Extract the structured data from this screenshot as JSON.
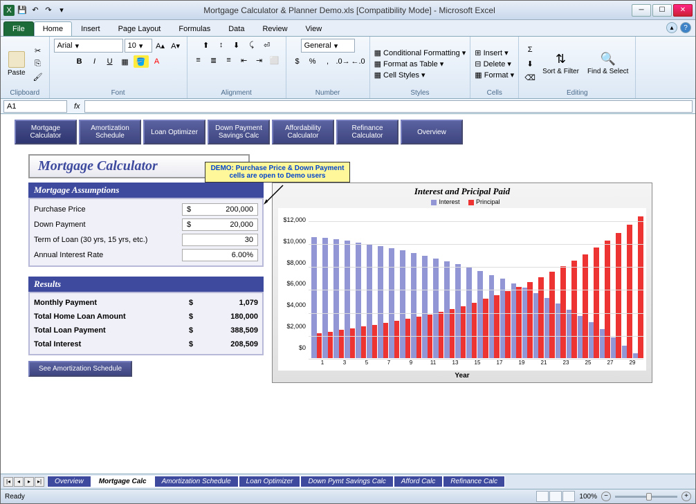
{
  "window": {
    "title": "Mortgage Calculator & Planner Demo.xls  [Compatibility Mode]  -  Microsoft Excel"
  },
  "ribbon": {
    "tabs": [
      "File",
      "Home",
      "Insert",
      "Page Layout",
      "Formulas",
      "Data",
      "Review",
      "View"
    ],
    "active_tab": "Home",
    "groups": {
      "clipboard": "Clipboard",
      "font": "Font",
      "alignment": "Alignment",
      "number": "Number",
      "styles": "Styles",
      "cells": "Cells",
      "editing": "Editing"
    },
    "paste": "Paste",
    "font_name": "Arial",
    "font_size": "10",
    "number_format": "General",
    "cond_fmt": "Conditional Formatting",
    "table_fmt": "Format as Table",
    "cell_styles": "Cell Styles",
    "insert": "Insert",
    "delete": "Delete",
    "format": "Format",
    "sort": "Sort & Filter",
    "find": "Find & Select"
  },
  "formula": {
    "cell_ref": "A1",
    "fx": "fx"
  },
  "nav_buttons": [
    "Mortgage Calculator",
    "Amortization Schedule",
    "Loan Optimizer",
    "Down Payment Savings Calc",
    "Affordability Calculator",
    "Refinance Calculator",
    "Overview"
  ],
  "page_title": "Mortgage Calculator",
  "callout": "DEMO:  Purchase Price & Down Payment cells are open to Demo users",
  "assumptions": {
    "header": "Mortgage Assumptions",
    "fields": [
      {
        "label": "Purchase Price",
        "currency": "$",
        "value": "200,000"
      },
      {
        "label": "Down Payment",
        "currency": "$",
        "value": "20,000"
      },
      {
        "label": "Term of Loan (30 yrs, 15 yrs, etc.)",
        "currency": "",
        "value": "30"
      },
      {
        "label": "Annual Interest Rate",
        "currency": "",
        "value": "6.00%"
      }
    ]
  },
  "results": {
    "header": "Results",
    "rows": [
      {
        "label": "Monthly Payment",
        "currency": "$",
        "value": "1,079"
      },
      {
        "label": "Total Home Loan Amount",
        "currency": "$",
        "value": "180,000"
      },
      {
        "label": "Total Loan Payment",
        "currency": "$",
        "value": "388,509"
      },
      {
        "label": "Total Interest",
        "currency": "$",
        "value": "208,509"
      }
    ]
  },
  "action_button": "See Amortization Schedule",
  "chart_data": {
    "type": "bar",
    "title": "Interest and Pricipal Paid",
    "xlabel": "Year",
    "ylabel": "",
    "ylim": [
      0,
      13000
    ],
    "yticks": [
      "$0",
      "$2,000",
      "$4,000",
      "$6,000",
      "$8,000",
      "$10,000",
      "$12,000"
    ],
    "categories": [
      1,
      2,
      3,
      4,
      5,
      6,
      7,
      8,
      9,
      10,
      11,
      12,
      13,
      14,
      15,
      16,
      17,
      18,
      19,
      20,
      21,
      22,
      23,
      24,
      25,
      26,
      27,
      28,
      29,
      30
    ],
    "xtick_labels": [
      "1",
      "3",
      "5",
      "7",
      "9",
      "11",
      "13",
      "15",
      "17",
      "19",
      "21",
      "23",
      "25",
      "27",
      "29"
    ],
    "series": [
      {
        "name": "Interest",
        "color": "#9296d4",
        "values": [
          10700,
          10600,
          10500,
          10350,
          10200,
          10050,
          9900,
          9700,
          9500,
          9300,
          9050,
          8800,
          8550,
          8300,
          8000,
          7700,
          7350,
          7000,
          6600,
          6200,
          5750,
          5300,
          4800,
          4300,
          3750,
          3150,
          2550,
          1850,
          1100,
          400
        ]
      },
      {
        "name": "Principal",
        "color": "#e33",
        "values": [
          2200,
          2350,
          2500,
          2650,
          2800,
          2950,
          3100,
          3300,
          3450,
          3650,
          3850,
          4100,
          4350,
          4600,
          4900,
          5250,
          5550,
          5900,
          6300,
          6700,
          7150,
          7600,
          8100,
          8600,
          9150,
          9750,
          10350,
          11050,
          11800,
          12500
        ]
      }
    ]
  },
  "sheet_tabs": [
    "Overview",
    "Mortgage Calc",
    "Amortization Schedule",
    "Loan Optimizer",
    "Down Pymt Savings Calc",
    "Afford Calc",
    "Refinance Calc"
  ],
  "active_sheet": "Mortgage Calc",
  "status": {
    "text": "Ready",
    "zoom": "100%"
  }
}
